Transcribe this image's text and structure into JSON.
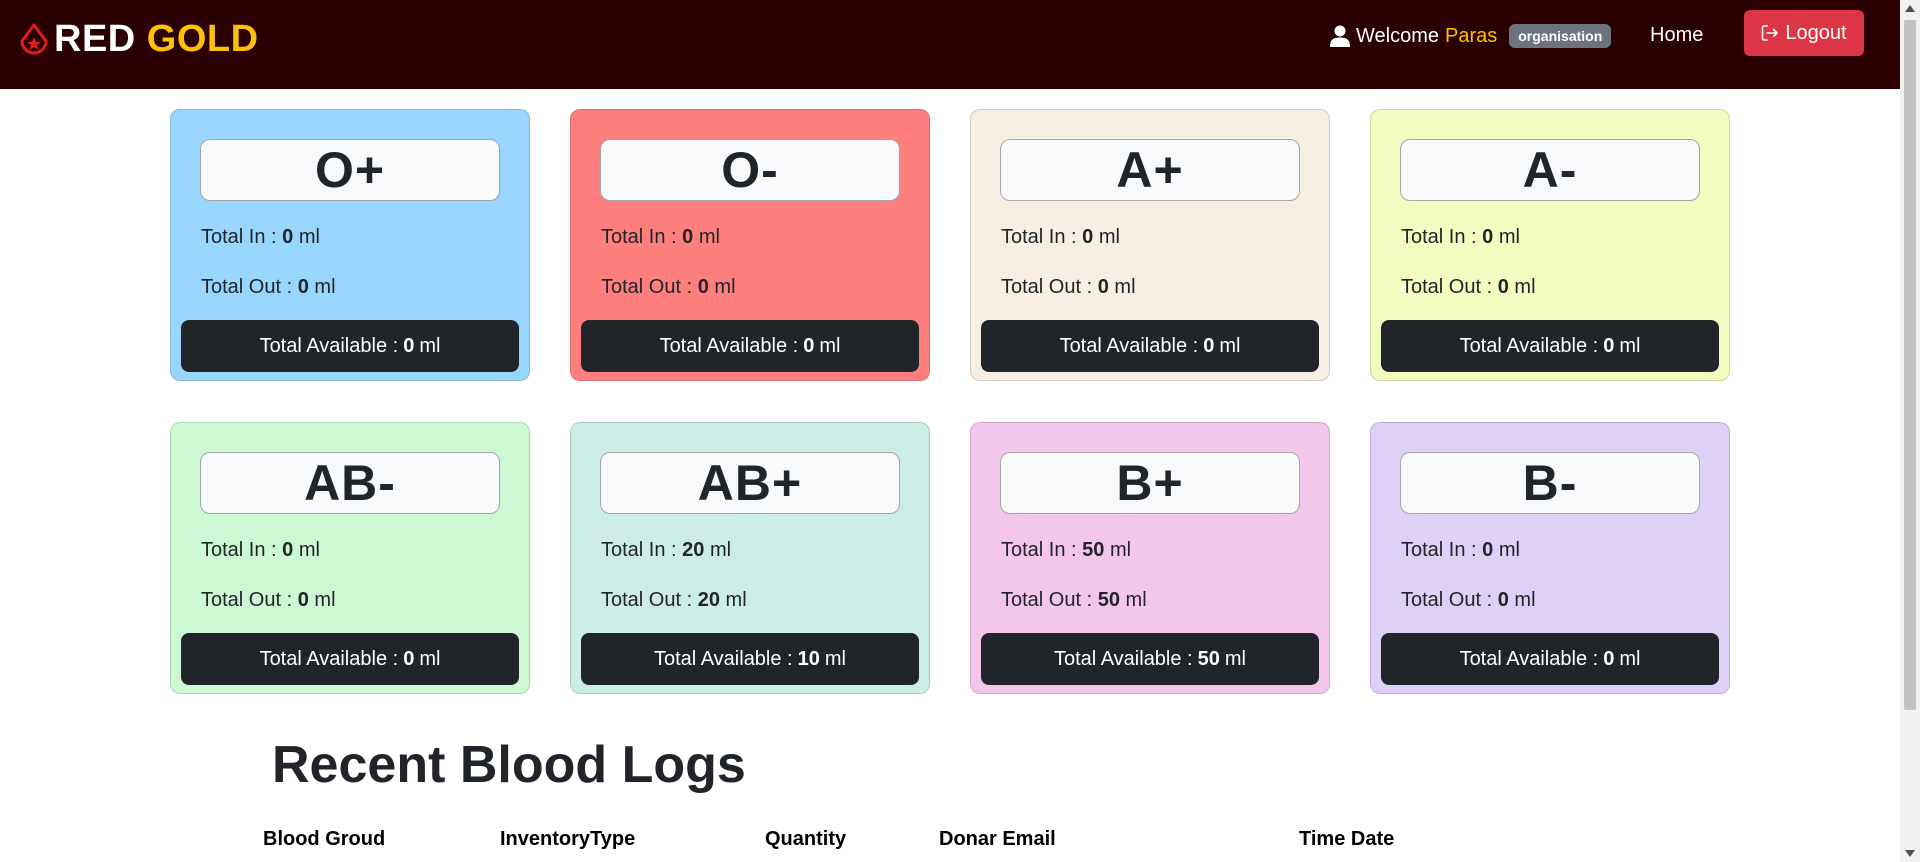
{
  "navbar": {
    "brand_part1": "RED",
    "brand_part2": "GOLD",
    "welcome_text": "Welcome",
    "username": "Paras",
    "role": "organisation",
    "home_label": "Home",
    "logout_label": "Logout",
    "icons": [
      "blood-drop-icon",
      "user-icon",
      "logout-icon"
    ]
  },
  "labels": {
    "total_in": "Total In :",
    "total_out": "Total Out :",
    "total_available": "Total Available :",
    "unit": "ml"
  },
  "cards": [
    {
      "group": "O+",
      "total_in": "0",
      "total_out": "0",
      "available": "0",
      "color": "#99d6fd"
    },
    {
      "group": "O-",
      "total_in": "0",
      "total_out": "0",
      "available": "0",
      "color": "#ff7f7f"
    },
    {
      "group": "A+",
      "total_in": "0",
      "total_out": "0",
      "available": "0",
      "color": "#f8efe4"
    },
    {
      "group": "A-",
      "total_in": "0",
      "total_out": "0",
      "available": "0",
      "color": "#f2fcc1"
    },
    {
      "group": "AB-",
      "total_in": "0",
      "total_out": "0",
      "available": "0",
      "color": "#cdf8d4"
    },
    {
      "group": "AB+",
      "total_in": "20",
      "total_out": "20",
      "available": "10",
      "color": "#ccede6"
    },
    {
      "group": "B+",
      "total_in": "50",
      "total_out": "50",
      "available": "50",
      "color": "#f4c7ea"
    },
    {
      "group": "B-",
      "total_in": "0",
      "total_out": "0",
      "available": "0",
      "color": "#dfd0f8"
    }
  ],
  "logs": {
    "title": "Recent Blood Logs",
    "columns": [
      "Blood Groud",
      "InventoryType",
      "Quantity",
      "Donar Email",
      "Time Date"
    ]
  },
  "colors": {
    "navbar_bg": "#2a0002",
    "brand_accent": "#ffc107",
    "logout_bg": "#dc3545",
    "available_bg": "#212529"
  }
}
